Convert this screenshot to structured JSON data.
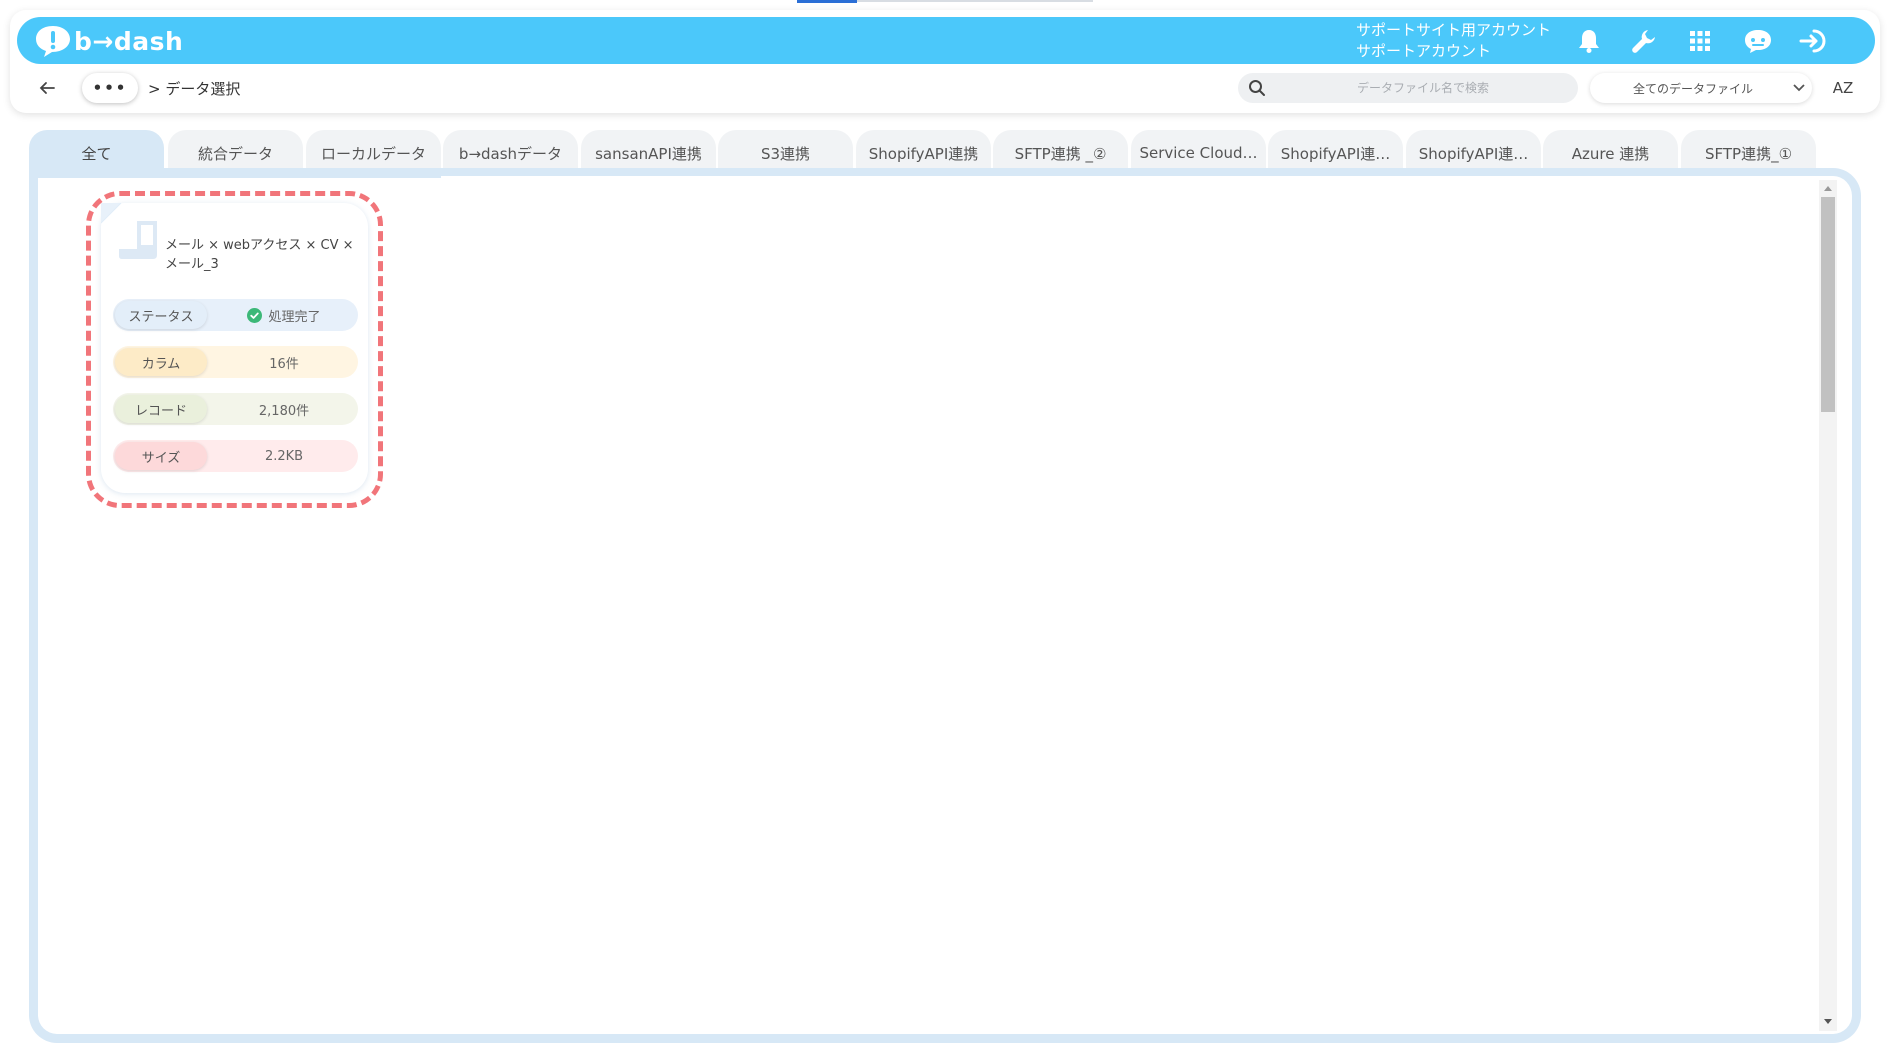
{
  "app": {
    "logo_text": "b→dash",
    "account_line1": "サポートサイト用アカウント",
    "account_line2": "サポートアカウント"
  },
  "header_icons": [
    "bell-icon",
    "wrench-icon",
    "grid-icon",
    "chat-bot-icon",
    "logout-icon"
  ],
  "breadcrumb": {
    "separator": ">",
    "current": "データ選択"
  },
  "search": {
    "placeholder": "データファイル名で検索",
    "value": ""
  },
  "filter": {
    "selected": "全てのデータファイル"
  },
  "sort_label": "AZ",
  "tabs": [
    {
      "label": "全て",
      "active": true
    },
    {
      "label": "統合データ"
    },
    {
      "label": "ローカルデータ"
    },
    {
      "label": "b→dashデータ"
    },
    {
      "label": "sansanAPI連携"
    },
    {
      "label": "S3連携"
    },
    {
      "label": "ShopifyAPI連携"
    },
    {
      "label": "SFTP連携 _②"
    },
    {
      "label": "Service Cloud…"
    },
    {
      "label": "ShopifyAPI連…"
    },
    {
      "label": "ShopifyAPI連…"
    },
    {
      "label": "Azure 連携"
    },
    {
      "label": "SFTP連携_①"
    }
  ],
  "card": {
    "title_line1": "メール × webアクセス × CV ×",
    "title_line2": "メール_3",
    "status_label": "ステータス",
    "status_value": "処理完了",
    "column_label": "カラム",
    "column_value": "16件",
    "record_label": "レコード",
    "record_value": "2,180件",
    "size_label": "サイズ",
    "size_value": "2.2KB"
  },
  "colors": {
    "header_bg": "#4bc8fa",
    "tab_active": "#d7e8f6",
    "highlight": "#f1757a",
    "status_ok": "#3cb878"
  }
}
